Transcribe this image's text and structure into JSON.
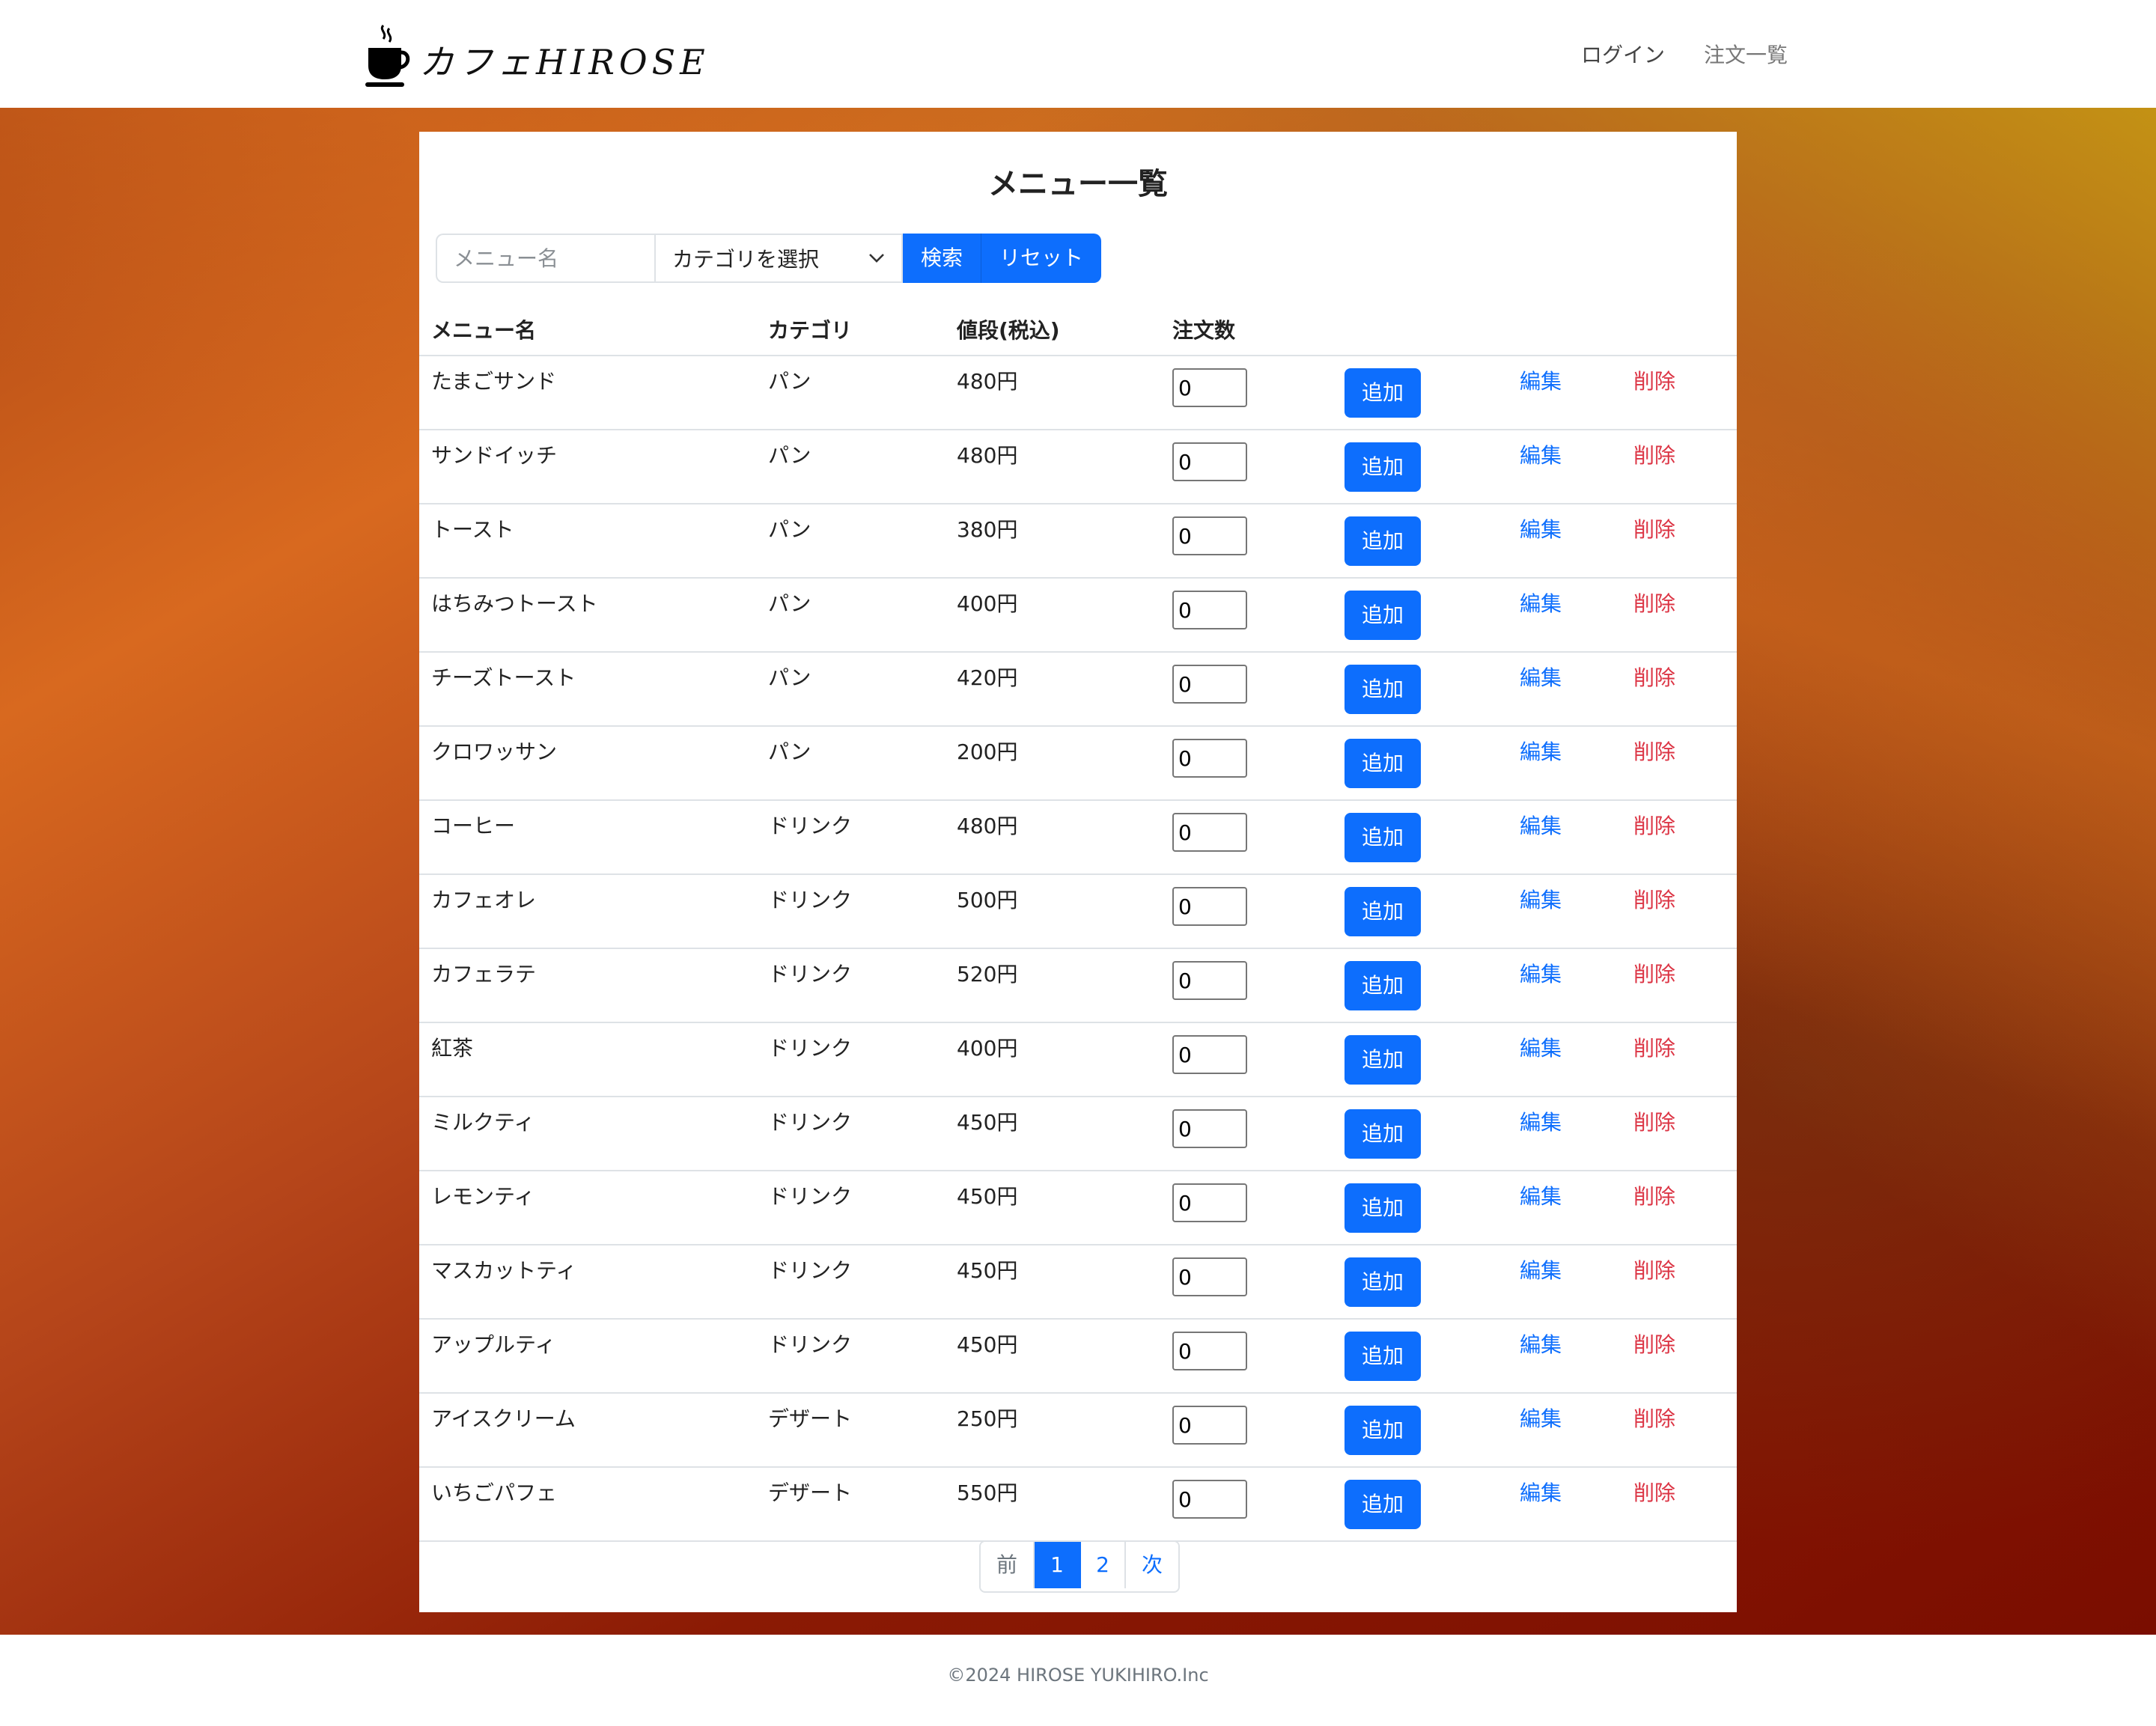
{
  "header": {
    "brand": "カフェHIROSE",
    "nav": {
      "login": "ログイン",
      "orders": "注文一覧"
    }
  },
  "page": {
    "title": "メニュー一覧"
  },
  "search": {
    "name_placeholder": "メニュー名",
    "category_value": "カテゴリを選択",
    "search_label": "検索",
    "reset_label": "リセット"
  },
  "table": {
    "headers": {
      "name": "メニュー名",
      "category": "カテゴリ",
      "price": "値段(税込)",
      "quantity": "注文数"
    },
    "add_label": "追加",
    "edit_label": "編集",
    "delete_label": "削除",
    "rows": [
      {
        "name": "たまごサンド",
        "category": "パン",
        "price": "480円",
        "qty": "0"
      },
      {
        "name": "サンドイッチ",
        "category": "パン",
        "price": "480円",
        "qty": "0"
      },
      {
        "name": "トースト",
        "category": "パン",
        "price": "380円",
        "qty": "0"
      },
      {
        "name": "はちみつトースト",
        "category": "パン",
        "price": "400円",
        "qty": "0"
      },
      {
        "name": "チーズトースト",
        "category": "パン",
        "price": "420円",
        "qty": "0"
      },
      {
        "name": "クロワッサン",
        "category": "パン",
        "price": "200円",
        "qty": "0"
      },
      {
        "name": "コーヒー",
        "category": "ドリンク",
        "price": "480円",
        "qty": "0"
      },
      {
        "name": "カフェオレ",
        "category": "ドリンク",
        "price": "500円",
        "qty": "0"
      },
      {
        "name": "カフェラテ",
        "category": "ドリンク",
        "price": "520円",
        "qty": "0"
      },
      {
        "name": "紅茶",
        "category": "ドリンク",
        "price": "400円",
        "qty": "0"
      },
      {
        "name": "ミルクティ",
        "category": "ドリンク",
        "price": "450円",
        "qty": "0"
      },
      {
        "name": "レモンティ",
        "category": "ドリンク",
        "price": "450円",
        "qty": "0"
      },
      {
        "name": "マスカットティ",
        "category": "ドリンク",
        "price": "450円",
        "qty": "0"
      },
      {
        "name": "アップルティ",
        "category": "ドリンク",
        "price": "450円",
        "qty": "0"
      },
      {
        "name": "アイスクリーム",
        "category": "デザート",
        "price": "250円",
        "qty": "0"
      },
      {
        "name": "いちごパフェ",
        "category": "デザート",
        "price": "550円",
        "qty": "0"
      }
    ]
  },
  "pagination": {
    "prev": "前",
    "pages": [
      "1",
      "2"
    ],
    "current": "1",
    "next": "次"
  },
  "footer": {
    "text": "©2024 HIROSE YUKIHIRO.Inc"
  },
  "colors": {
    "primary": "#0d6efd",
    "danger": "#dc3545",
    "border": "#dee2e6"
  },
  "icons": {
    "brand": "coffee-cup-icon",
    "select": "chevron-down-icon"
  }
}
